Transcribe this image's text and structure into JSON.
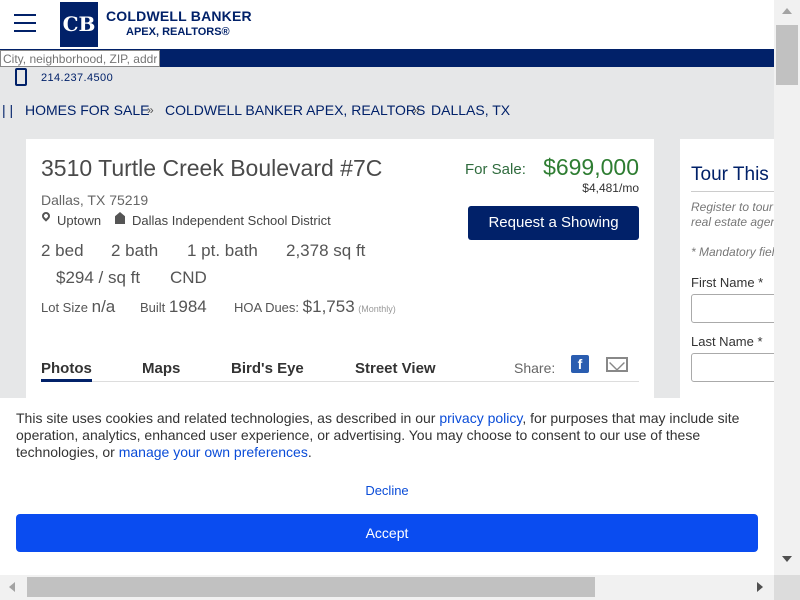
{
  "header": {
    "logo_mark": "CB",
    "brand_line1": "COLDWELL BANKER",
    "brand_line2": "APEX, REALTORS®",
    "search_placeholder": "City, neighborhood, ZIP, address",
    "phone": "214.237.4500"
  },
  "breadcrumb": {
    "bars": "| |",
    "items": [
      "HOMES FOR SALE",
      "COLDWELL BANKER APEX, REALTORS",
      "DALLAS, TX"
    ],
    "separator": "»"
  },
  "listing": {
    "address": "3510 Turtle Creek Boulevard #7C",
    "city_line": "Dallas, TX 75219",
    "neighborhood": "Uptown",
    "school": "Dallas Independent School District",
    "beds": "2 bed",
    "baths": "2 bath",
    "partial_baths": "1 pt. bath",
    "sqft": "2,378 sq ft",
    "price_per_sqft": "$294 / sq ft",
    "property_type": "CND",
    "lot_size_label": "Lot Size",
    "lot_size_value": "n/a",
    "built_label": "Built",
    "built_value": "1984",
    "hoa_label": "HOA Dues:",
    "hoa_value": "$1,753",
    "hoa_period": "(Monthly)",
    "for_sale_label": "For Sale:",
    "price": "$699,000",
    "per_month": "$4,481/mo",
    "request_showing": "Request a Showing",
    "tabs": [
      "Photos",
      "Maps",
      "Bird's Eye",
      "Street View"
    ],
    "share_label": "Share:",
    "facebook_glyph": "f"
  },
  "tour": {
    "title": "Tour This Home",
    "description": "Register to tour with a real estate agent.",
    "mandatory": "* Mandatory fields",
    "first_name_label": "First Name *",
    "last_name_label": "Last Name *"
  },
  "cookie": {
    "text_before": "This site uses cookies and related technologies, as described in our ",
    "privacy_link": "privacy policy",
    "text_middle": ", for purposes that may include site operation, analytics, enhanced user experience, or advertising. You may choose to consent to our use of these technologies, or ",
    "prefs_link": "manage your own preferences",
    "text_after": ".",
    "decline": "Decline",
    "accept": "Accept"
  },
  "colors": {
    "brand_navy": "#012169",
    "price_green": "#2e7d32",
    "accept_blue": "#0a4cf0"
  }
}
